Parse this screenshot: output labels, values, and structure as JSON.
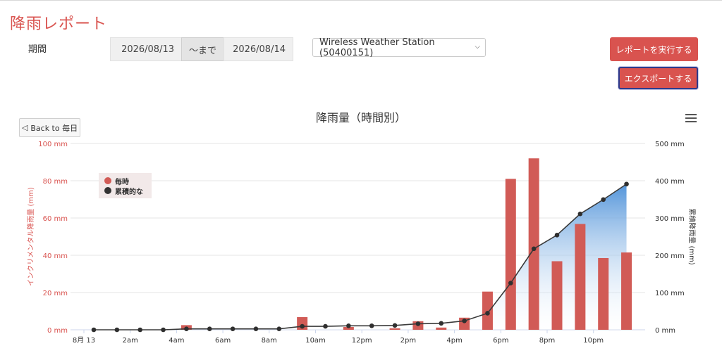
{
  "header": {
    "title": "降雨レポート"
  },
  "filters": {
    "period_label": "期間",
    "date_from": "2026/08/13",
    "range_separator": "〜まで",
    "date_to": "2026/08/14",
    "station": "Wireless Weather Station (50400151)"
  },
  "buttons": {
    "run_report": "レポートを実行する",
    "export": "エクスポートする",
    "back": "Back to 毎日"
  },
  "colors": {
    "accent": "#d9534f",
    "bar": "#d15b56",
    "line": "#333333",
    "area_top": "#4a8fd8"
  },
  "chart_data": {
    "type": "bar",
    "title": "降雨量（時間別）",
    "ylabel": "インクリメンタル降雨量 (mm)",
    "y2label": "累積降雨量 (mm)",
    "ylim": [
      0,
      100
    ],
    "y2lim": [
      0,
      500
    ],
    "y_ticks": [
      "0 mm",
      "20 mm",
      "40 mm",
      "60 mm",
      "80 mm",
      "100 mm"
    ],
    "y2_ticks": [
      "0 mm",
      "100 mm",
      "200 mm",
      "300 mm",
      "400 mm",
      "500 mm"
    ],
    "x_tick_labels": [
      "8月 13",
      "2am",
      "4am",
      "6am",
      "8am",
      "10am",
      "12pm",
      "2pm",
      "4pm",
      "6pm",
      "8pm",
      "10pm"
    ],
    "hours": [
      0,
      1,
      2,
      3,
      4,
      5,
      6,
      7,
      8,
      9,
      10,
      11,
      12,
      13,
      14,
      15,
      16,
      17,
      18,
      19,
      20,
      21,
      22,
      23
    ],
    "grid": true,
    "legend_position": "top-left",
    "series": [
      {
        "name": "毎時",
        "type": "bar",
        "axis": "left",
        "color": "#d15b56",
        "values": [
          0,
          0,
          0,
          0,
          2.5,
          0,
          0,
          0,
          0,
          6.8,
          0,
          1.5,
          0,
          0.8,
          4.6,
          1.2,
          6.5,
          20.5,
          81,
          92,
          36.8,
          56.8,
          38.5,
          41.5
        ]
      },
      {
        "name": "累積的な",
        "type": "area-line",
        "axis": "right",
        "color": "#333333",
        "values": [
          0,
          0,
          0,
          0,
          2.5,
          2.5,
          2.5,
          2.5,
          2.5,
          9.3,
          9.3,
          10.8,
          10.8,
          11.6,
          16.2,
          17.4,
          23.9,
          44.4,
          125.4,
          217.4,
          254.2,
          311,
          349.5,
          391
        ]
      }
    ]
  }
}
